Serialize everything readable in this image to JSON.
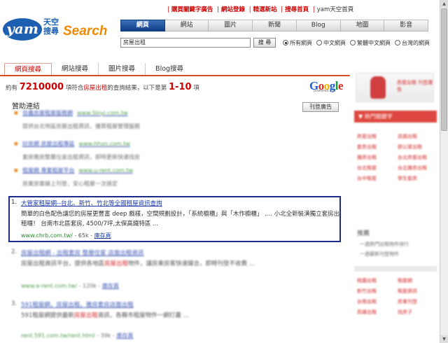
{
  "top_links": [
    "購買關鍵字廣告",
    "網站登錄",
    "精選新站",
    "搜尋首頁"
  ],
  "top_links_plain": "yam天空首頁",
  "logo": {
    "yam": "yam",
    "cn_line1": "天空",
    "cn_line2": "搜尋",
    "search": "Search"
  },
  "tabs": [
    "網頁",
    "網站",
    "圖片",
    "新聞",
    "Blog",
    "地圖",
    "影音"
  ],
  "search": {
    "value": "房屋出租",
    "button": "搜 尋"
  },
  "radios": [
    {
      "label": "所有網頁",
      "selected": true
    },
    {
      "label": "中文網頁",
      "selected": false
    },
    {
      "label": "繁體中文網頁",
      "selected": false
    },
    {
      "label": "台灣的網頁",
      "selected": false
    }
  ],
  "result_tabs": [
    "網頁搜尋",
    "網站搜尋",
    "圖片搜尋",
    "Blog搜尋"
  ],
  "count_line": {
    "prefix": "約有",
    "count": "7210000",
    "mid": "項符合",
    "query": "房屋出租",
    "mid2": "的查詢結果，以下是第",
    "range": "1-10",
    "suffix": "項"
  },
  "google": {
    "g1": "G",
    "g2": "o",
    "g3": "o",
    "g4": "g",
    "g5": "l",
    "g6": "e",
    "powered": "powered by"
  },
  "sponsor": {
    "title": "贊助連結",
    "buy_button": "刊登廣告",
    "items": [
      {
        "title": "信義房屋租屋服務網",
        "url": "www.Sinyi.com.tw",
        "desc": "提供台北地區房屋出租資訊，優質租屋管理服務"
      },
      {
        "title": "好房網 房屋出租專區",
        "url": "www.hhon.com.tw",
        "desc": "套房雅房整層住家出租資訊，即時更新快速找房"
      },
      {
        "title": "租屋網 專業租屋平台",
        "url": "www.u-rent.com.tw",
        "desc": "房東房客線上刊登，安心租屋一次搞定"
      }
    ]
  },
  "results": [
    {
      "num": "1.",
      "title": "大管家租屋網--台北、新竹、竹北等全國租屋資訊查詢",
      "desc_a": "簡單的白色配色讓您的房屋更豐富 deep 戲樣，空間規劃設計，「系統櫥櫃」與「木作櫥櫃」 .... 小北全新裝潢獨立套房出租囉！ 台南市北區套房, 4500/7坪,太保高鐵特區 ...",
      "url": "www.chrb.com.tw/",
      "size": "- 65k -",
      "cache": "庫存頁"
    },
    {
      "num": "2.",
      "title": "房屋出租網 - 出租套房 整層住家 店面出租資訊",
      "desc_a": "房屋出租資訊平台，提供各地區",
      "desc_hl": "房屋出租",
      "desc_b": "物件，讓房東房客快速媒合，即時刊登不收費 ...",
      "url": "www.e-rent.com.tw/",
      "size": "- 120k -",
      "cache": "庫存頁"
    },
    {
      "num": "3.",
      "title": "591租屋網，房屋出租，雅房套房店面出租",
      "desc_a": "591租屋網提供最新",
      "desc_hl": "房屋出租",
      "desc_b": "資訊，各縣市租屋物件一網打盡 ...",
      "url": "rent.591.com.tw/rent.html",
      "size": "- 39k -",
      "cache": "庫存頁"
    }
  ],
  "sidebar": {
    "banner": "房屋出租 刊登廣告",
    "head": "▼ 熱門關鍵字",
    "col1": [
      "房屋出租",
      "套房出租",
      "雅房出租",
      "台北租屋",
      "台中租屋"
    ],
    "col2": [
      "店面出租",
      "辦公室出租",
      "台北房屋出租",
      "台北雅房出租",
      "學生套房"
    ],
    "section": "推薦",
    "small": [
      "一週熱門出租物件排行",
      "一週最新刊登物件"
    ],
    "col1b": [
      "桃園出租",
      "新竹出租",
      "台南出租",
      "高雄出租"
    ],
    "col2b": [
      "租屋網",
      "租屋資訊",
      "房東刊登",
      "找房子"
    ]
  }
}
